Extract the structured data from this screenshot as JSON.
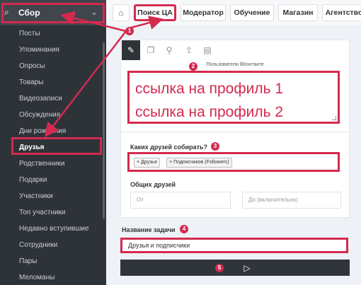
{
  "sidebar": {
    "header_title": "Сбор",
    "items": [
      {
        "label": "Посты"
      },
      {
        "label": "Упоминания"
      },
      {
        "label": "Опросы"
      },
      {
        "label": "Товары"
      },
      {
        "label": "Видеозаписи"
      },
      {
        "label": "Обсуждения"
      },
      {
        "label": "Дни рождения"
      },
      {
        "label": "Друзья",
        "active": true
      },
      {
        "label": "Родственники"
      },
      {
        "label": "Подарки"
      },
      {
        "label": "Участники"
      },
      {
        "label": "Топ участники"
      },
      {
        "label": "Недавно вступившие"
      },
      {
        "label": "Сотрудники"
      },
      {
        "label": "Пары"
      },
      {
        "label": "Меломаны"
      }
    ]
  },
  "tabs": [
    {
      "label": "Поиск ЦА",
      "active": true
    },
    {
      "label": "Модератор"
    },
    {
      "label": "Обучение"
    },
    {
      "label": "Магазин"
    },
    {
      "label": "Агентство"
    }
  ],
  "toolbar_icons": [
    "edit-icon",
    "copy-icon",
    "location-icon",
    "upload-icon",
    "book-icon"
  ],
  "form": {
    "source_label": "Пользователи ВКонтакте",
    "source_lines": [
      "ссылка на профиль 1",
      "ссылка на профиль 2"
    ],
    "friends_label": "Каких друзей собирать?",
    "friend_tags": [
      "Друзья",
      "Подписчиков (Followers)"
    ],
    "common_label": "Общих друзей",
    "from_placeholder": "От",
    "to_placeholder": "До (включительно)",
    "task_label": "Название задачи",
    "task_value": "Друзья и подписчики"
  },
  "badges": [
    "1",
    "2",
    "3",
    "4",
    "5"
  ],
  "colors": {
    "accent": "#d42a4f",
    "sidebar": "#2e3338"
  }
}
